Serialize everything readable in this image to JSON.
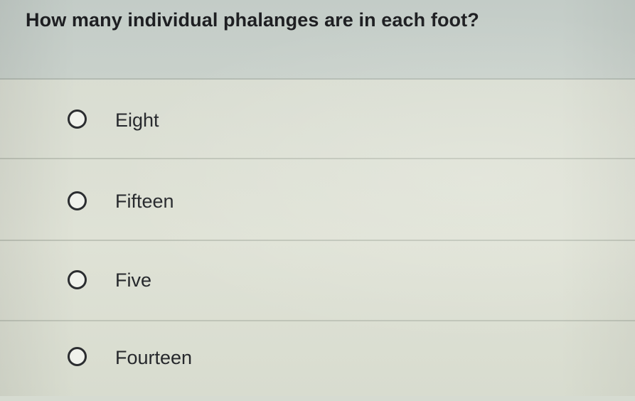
{
  "question": {
    "text": "How many individual phalanges are in each foot?"
  },
  "options": [
    {
      "label": "Eight",
      "selected": false
    },
    {
      "label": "Fifteen",
      "selected": false
    },
    {
      "label": "Five",
      "selected": false
    },
    {
      "label": "Fourteen",
      "selected": false
    }
  ]
}
